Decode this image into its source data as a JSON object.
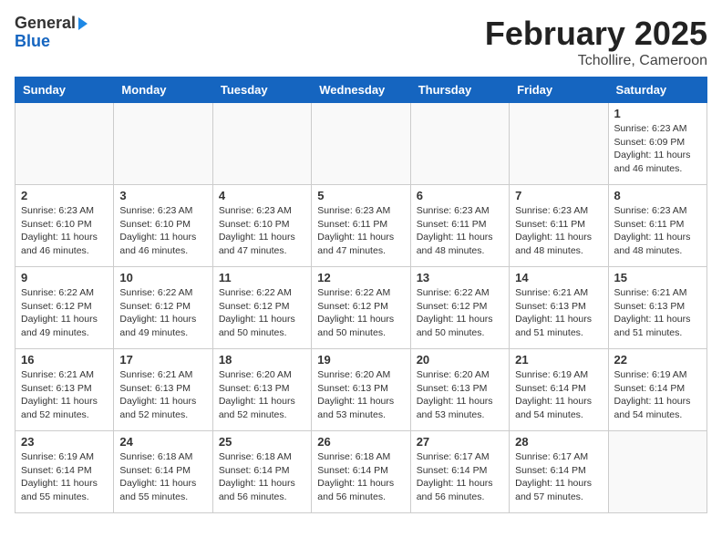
{
  "header": {
    "logo_general": "General",
    "logo_blue": "Blue",
    "title": "February 2025",
    "location": "Tchollire, Cameroon"
  },
  "weekdays": [
    "Sunday",
    "Monday",
    "Tuesday",
    "Wednesday",
    "Thursday",
    "Friday",
    "Saturday"
  ],
  "weeks": [
    [
      {
        "day": "",
        "info": ""
      },
      {
        "day": "",
        "info": ""
      },
      {
        "day": "",
        "info": ""
      },
      {
        "day": "",
        "info": ""
      },
      {
        "day": "",
        "info": ""
      },
      {
        "day": "",
        "info": ""
      },
      {
        "day": "1",
        "info": "Sunrise: 6:23 AM\nSunset: 6:09 PM\nDaylight: 11 hours and 46 minutes."
      }
    ],
    [
      {
        "day": "2",
        "info": "Sunrise: 6:23 AM\nSunset: 6:10 PM\nDaylight: 11 hours and 46 minutes."
      },
      {
        "day": "3",
        "info": "Sunrise: 6:23 AM\nSunset: 6:10 PM\nDaylight: 11 hours and 46 minutes."
      },
      {
        "day": "4",
        "info": "Sunrise: 6:23 AM\nSunset: 6:10 PM\nDaylight: 11 hours and 47 minutes."
      },
      {
        "day": "5",
        "info": "Sunrise: 6:23 AM\nSunset: 6:11 PM\nDaylight: 11 hours and 47 minutes."
      },
      {
        "day": "6",
        "info": "Sunrise: 6:23 AM\nSunset: 6:11 PM\nDaylight: 11 hours and 48 minutes."
      },
      {
        "day": "7",
        "info": "Sunrise: 6:23 AM\nSunset: 6:11 PM\nDaylight: 11 hours and 48 minutes."
      },
      {
        "day": "8",
        "info": "Sunrise: 6:23 AM\nSunset: 6:11 PM\nDaylight: 11 hours and 48 minutes."
      }
    ],
    [
      {
        "day": "9",
        "info": "Sunrise: 6:22 AM\nSunset: 6:12 PM\nDaylight: 11 hours and 49 minutes."
      },
      {
        "day": "10",
        "info": "Sunrise: 6:22 AM\nSunset: 6:12 PM\nDaylight: 11 hours and 49 minutes."
      },
      {
        "day": "11",
        "info": "Sunrise: 6:22 AM\nSunset: 6:12 PM\nDaylight: 11 hours and 50 minutes."
      },
      {
        "day": "12",
        "info": "Sunrise: 6:22 AM\nSunset: 6:12 PM\nDaylight: 11 hours and 50 minutes."
      },
      {
        "day": "13",
        "info": "Sunrise: 6:22 AM\nSunset: 6:12 PM\nDaylight: 11 hours and 50 minutes."
      },
      {
        "day": "14",
        "info": "Sunrise: 6:21 AM\nSunset: 6:13 PM\nDaylight: 11 hours and 51 minutes."
      },
      {
        "day": "15",
        "info": "Sunrise: 6:21 AM\nSunset: 6:13 PM\nDaylight: 11 hours and 51 minutes."
      }
    ],
    [
      {
        "day": "16",
        "info": "Sunrise: 6:21 AM\nSunset: 6:13 PM\nDaylight: 11 hours and 52 minutes."
      },
      {
        "day": "17",
        "info": "Sunrise: 6:21 AM\nSunset: 6:13 PM\nDaylight: 11 hours and 52 minutes."
      },
      {
        "day": "18",
        "info": "Sunrise: 6:20 AM\nSunset: 6:13 PM\nDaylight: 11 hours and 52 minutes."
      },
      {
        "day": "19",
        "info": "Sunrise: 6:20 AM\nSunset: 6:13 PM\nDaylight: 11 hours and 53 minutes."
      },
      {
        "day": "20",
        "info": "Sunrise: 6:20 AM\nSunset: 6:13 PM\nDaylight: 11 hours and 53 minutes."
      },
      {
        "day": "21",
        "info": "Sunrise: 6:19 AM\nSunset: 6:14 PM\nDaylight: 11 hours and 54 minutes."
      },
      {
        "day": "22",
        "info": "Sunrise: 6:19 AM\nSunset: 6:14 PM\nDaylight: 11 hours and 54 minutes."
      }
    ],
    [
      {
        "day": "23",
        "info": "Sunrise: 6:19 AM\nSunset: 6:14 PM\nDaylight: 11 hours and 55 minutes."
      },
      {
        "day": "24",
        "info": "Sunrise: 6:18 AM\nSunset: 6:14 PM\nDaylight: 11 hours and 55 minutes."
      },
      {
        "day": "25",
        "info": "Sunrise: 6:18 AM\nSunset: 6:14 PM\nDaylight: 11 hours and 56 minutes."
      },
      {
        "day": "26",
        "info": "Sunrise: 6:18 AM\nSunset: 6:14 PM\nDaylight: 11 hours and 56 minutes."
      },
      {
        "day": "27",
        "info": "Sunrise: 6:17 AM\nSunset: 6:14 PM\nDaylight: 11 hours and 56 minutes."
      },
      {
        "day": "28",
        "info": "Sunrise: 6:17 AM\nSunset: 6:14 PM\nDaylight: 11 hours and 57 minutes."
      },
      {
        "day": "",
        "info": ""
      }
    ]
  ]
}
